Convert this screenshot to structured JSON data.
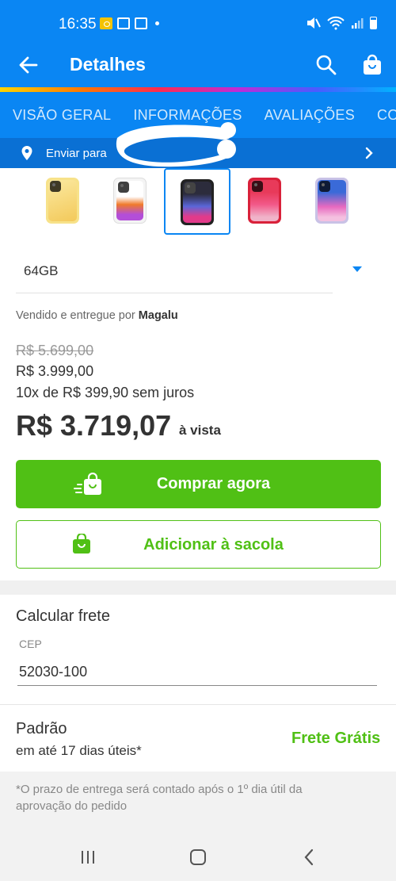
{
  "status_bar": {
    "time": "16:35"
  },
  "app_bar": {
    "title": "Detalhes"
  },
  "tabs": [
    {
      "label": "VISÃO GERAL"
    },
    {
      "label": "INFORMAÇÕES"
    },
    {
      "label": "AVALIAÇÕES"
    },
    {
      "label": "COM"
    }
  ],
  "shipping_bar": {
    "label": "Enviar para"
  },
  "color_options": [
    {
      "color": "#f7e28a",
      "selected": false
    },
    {
      "color": "#f4f4f4",
      "selected": false
    },
    {
      "color": "#222222",
      "selected": true
    },
    {
      "color": "#d9213a",
      "selected": false
    },
    {
      "color": "#c9c2e6",
      "selected": false
    }
  ],
  "storage": {
    "selected": "64GB"
  },
  "seller": {
    "prefix": "Vendido e entregue por",
    "name": "Magalu"
  },
  "price": {
    "old": "R$ 5.699,00",
    "from": "R$ 3.999,00",
    "installments": "10x de R$ 399,90 sem juros",
    "cash": "R$ 3.719,07",
    "cash_suffix": "à vista"
  },
  "actions": {
    "buy_now": "Comprar agora",
    "add_to_bag": "Adicionar à sacola"
  },
  "freight": {
    "title": "Calcular frete",
    "cep_label": "CEP",
    "cep_value": "52030-100",
    "method_name": "Padrão",
    "method_eta": "em até 17 dias úteis*",
    "method_price": "Frete Grátis"
  },
  "note": "*O prazo de entrega será contado após o 1º dia útil da aprovação do pedido",
  "colors": {
    "brand_blue": "#0a86f3",
    "green": "#50c015"
  }
}
